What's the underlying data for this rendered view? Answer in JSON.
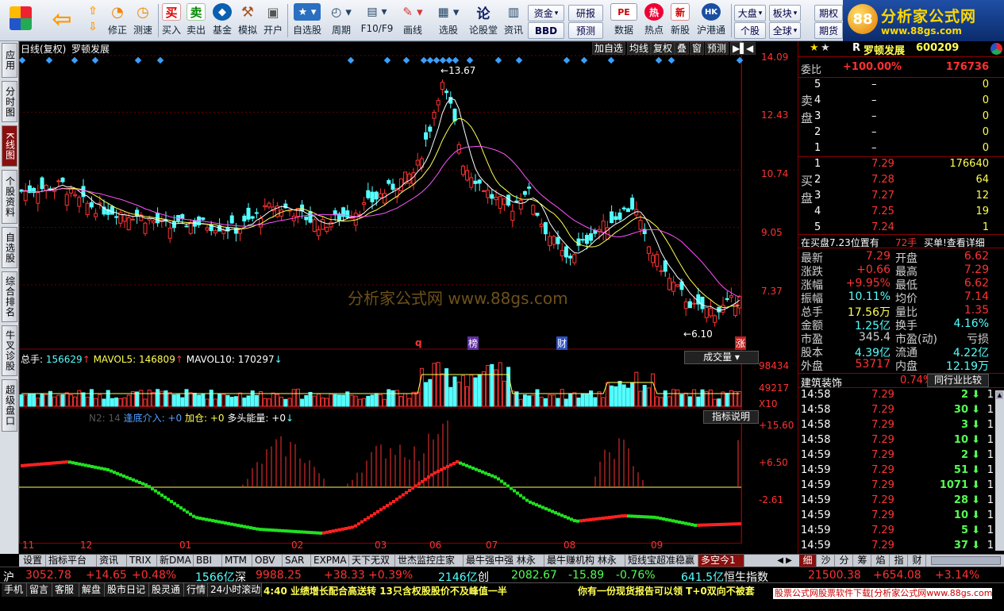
{
  "toolbar": {
    "buttons": [
      {
        "label": "",
        "icon": "grid-icon"
      },
      {
        "label": "",
        "icon": "back-arrow-icon"
      },
      {
        "label": "",
        "icon": "up-down-icon"
      },
      {
        "label": "修正",
        "icon": "fix-icon"
      },
      {
        "label": "测速",
        "icon": "speed-icon"
      },
      {
        "label": "买入",
        "icon": "buy-icon",
        "glyph": "买"
      },
      {
        "label": "卖出",
        "icon": "sell-icon",
        "glyph": "卖"
      },
      {
        "label": "基金",
        "icon": "fund-icon"
      },
      {
        "label": "模拟",
        "icon": "simulate-icon"
      },
      {
        "label": "开户",
        "icon": "lock-icon"
      },
      {
        "label": "自选股",
        "icon": "star-icon"
      },
      {
        "label": "周期",
        "icon": "clock-icon"
      },
      {
        "label": "F10/F9",
        "icon": "f10-icon"
      },
      {
        "label": "画线",
        "icon": "pen-icon"
      },
      {
        "label": "选股",
        "icon": "monitor-icon"
      },
      {
        "label": "论股堂",
        "icon": "forum-icon",
        "glyph": "论"
      },
      {
        "label": "资讯",
        "icon": "news-icon"
      },
      {
        "label": "数据",
        "icon": "pe-icon",
        "glyph": "PE"
      },
      {
        "label": "热点",
        "icon": "hot-icon",
        "glyph": "热"
      },
      {
        "label": "新股",
        "icon": "newstock-icon",
        "glyph": "新"
      },
      {
        "label": "沪港通",
        "icon": "hk-icon",
        "glyph": "HK"
      }
    ],
    "small_buttons": [
      "资金",
      "BBD",
      "研报",
      "预测",
      "大盘",
      "板块",
      "个股",
      "全球",
      "期权",
      "期货"
    ]
  },
  "brand": {
    "logo_text": "88",
    "title": "分析家公式网",
    "url": "www.88gs.com"
  },
  "left_tabs": [
    "应用",
    "分时图",
    "K线图",
    "个股资料",
    "自选股",
    "综合排名",
    "牛叉诊股",
    "超级盘口"
  ],
  "chart": {
    "header_left": "日线(复权)",
    "stock_name": "罗顿发展",
    "top_buttons": [
      "加自选",
      "均线",
      "复权",
      "叠",
      "窗",
      "预测"
    ],
    "price_ticks": [
      "14.09",
      "12.43",
      "10.74",
      "9.05",
      "7.37"
    ],
    "high_label": "13.67",
    "low_label": "6.10",
    "watermark": "分析家公式网  www.88gs.com",
    "event_markers": [
      "q",
      "榜",
      "财",
      "涨"
    ],
    "volume": {
      "total_label": "总手:",
      "total_value": "156629",
      "mavol5_label": "MAVOL5:",
      "mavol5_value": "146809",
      "mavol10_label": "MAVOL10:",
      "mavol10_value": "170297",
      "dropdown": "成交量",
      "ticks": [
        "98434",
        "49217",
        "X10"
      ]
    },
    "indicator": {
      "prefix": "N2: 14",
      "a_label": "逢底介入:",
      "a_value": "+0",
      "b_label": "加仓:",
      "b_value": "+0",
      "c_label": "多头能量:",
      "c_value": "+0",
      "button": "指标说明",
      "ticks": [
        "+15.60",
        "+6.50",
        "-2.61"
      ]
    },
    "months": [
      "11",
      "12",
      "01",
      "02",
      "03",
      "06",
      "07",
      "08",
      "09"
    ]
  },
  "chart_data": {
    "type": "candlestick",
    "price_axis": [
      14.09,
      12.43,
      10.74,
      9.05,
      7.37
    ],
    "high": 13.67,
    "low": 6.1,
    "volume_axis": [
      98434,
      49217
    ],
    "indicator_axis": [
      15.6,
      6.5,
      -2.61
    ],
    "colors": {
      "up": "#ff3232",
      "down": "#54ffff",
      "ma": "#ffffff"
    }
  },
  "right_panel": {
    "title": "罗顿发展",
    "code": "600209",
    "prefix": "R",
    "weibi_label": "委比",
    "weibi_value": "+100.00%",
    "weibi_diff": "176736",
    "sell_label": "卖盘",
    "buy_label": "买盘",
    "sells": [
      {
        "lvl": "5",
        "price": "–",
        "vol": "0"
      },
      {
        "lvl": "4",
        "price": "–",
        "vol": "0"
      },
      {
        "lvl": "3",
        "price": "–",
        "vol": "0"
      },
      {
        "lvl": "2",
        "price": "–",
        "vol": "0"
      },
      {
        "lvl": "1",
        "price": "–",
        "vol": "0"
      }
    ],
    "buys": [
      {
        "lvl": "1",
        "price": "7.29",
        "vol": "176640"
      },
      {
        "lvl": "2",
        "price": "7.28",
        "vol": "64"
      },
      {
        "lvl": "3",
        "price": "7.27",
        "vol": "12"
      },
      {
        "lvl": "4",
        "price": "7.25",
        "vol": "19"
      },
      {
        "lvl": "5",
        "price": "7.24",
        "vol": "1"
      }
    ],
    "notice": "在买盘7.23位置有",
    "notice_vol": "72手",
    "notice_link": "买单!查看详细",
    "stats": [
      {
        "l1": "最新",
        "v1": "7.29",
        "l2": "开盘",
        "v2": "6.62",
        "c1": "#ff3232",
        "c2": "#ff3232"
      },
      {
        "l1": "涨跌",
        "v1": "+0.66",
        "l2": "最高",
        "v2": "7.29",
        "c1": "#ff3232",
        "c2": "#ff3232"
      },
      {
        "l1": "涨幅",
        "v1": "+9.95%",
        "l2": "最低",
        "v2": "6.62",
        "c1": "#ff3232",
        "c2": "#ff3232"
      },
      {
        "l1": "振幅",
        "v1": "10.11%",
        "l2": "均价",
        "v2": "7.14",
        "c1": "#54ffff",
        "c2": "#ff3232"
      },
      {
        "l1": "总手",
        "v1": "17.56万",
        "l2": "量比",
        "v2": "1.35",
        "c1": "#ffff54",
        "c2": "#ff3232"
      },
      {
        "l1": "金额",
        "v1": "1.25亿",
        "l2": "换手",
        "v2": "4.16%",
        "c1": "#54ffff",
        "c2": "#54ffff"
      },
      {
        "l1": "市盈",
        "v1": "345.4",
        "l2": "市盈(动)",
        "v2": "亏损",
        "c1": "#d0d0d0",
        "c2": "#d0d0d0"
      },
      {
        "l1": "股本",
        "v1": "4.39亿",
        "l2": "流通",
        "v2": "4.22亿",
        "c1": "#54ffff",
        "c2": "#54ffff"
      },
      {
        "l1": "外盘",
        "v1": "53717",
        "l2": "内盘",
        "v2": "12.19万",
        "c1": "#ff3232",
        "c2": "#54ffff"
      }
    ],
    "sector": "建筑装饰",
    "sector_pct": "0.74%",
    "compare_button": "同行业比较",
    "ticks": [
      {
        "t": "14:58",
        "p": "7.29",
        "v": "2",
        "n": "1"
      },
      {
        "t": "14:58",
        "p": "7.29",
        "v": "30",
        "n": "1"
      },
      {
        "t": "14:58",
        "p": "7.29",
        "v": "3",
        "n": "1"
      },
      {
        "t": "14:58",
        "p": "7.29",
        "v": "10",
        "n": "1"
      },
      {
        "t": "14:59",
        "p": "7.29",
        "v": "2",
        "n": "1"
      },
      {
        "t": "14:59",
        "p": "7.29",
        "v": "51",
        "n": "1"
      },
      {
        "t": "14:59",
        "p": "7.29",
        "v": "1071",
        "n": "1"
      },
      {
        "t": "14:59",
        "p": "7.29",
        "v": "28",
        "n": "1"
      },
      {
        "t": "14:59",
        "p": "7.29",
        "v": "10",
        "n": "1"
      },
      {
        "t": "14:59",
        "p": "7.29",
        "v": "5",
        "n": "1"
      },
      {
        "t": "14:59",
        "p": "7.29",
        "v": "37",
        "n": "1"
      }
    ]
  },
  "bottom_tabs": [
    "设置",
    "指标平台",
    "资讯",
    "TRIX",
    "新DMA",
    "BBI",
    "MTM",
    "OBV",
    "SAR",
    "EXPMA",
    "天下无双",
    "世杰监控庄家",
    "最牛强中强 林永",
    "最牛赚机构 林永",
    "短线宝超准稳赢",
    "多空今1"
  ],
  "right_bottom_tabs": [
    "细",
    "沙",
    "分",
    "筹",
    "焰",
    "指",
    "财"
  ],
  "index_bar": {
    "sh_label": "沪",
    "sh_value": "3052.78",
    "sh_change": "+14.65",
    "sh_pct": "+0.48%",
    "sh_amount": "1566亿",
    "sz_label": "深",
    "sz_value": "9988.25",
    "sz_change": "+38.33",
    "sz_pct": "+0.39%",
    "sz_amount": "2146亿",
    "cy_label": "创",
    "cy_value": "2082.67",
    "cy_change": "-15.89",
    "cy_pct": "-0.76%",
    "cy_amount": "641.5亿",
    "hs_label": "恒生指数",
    "hs_value": "21500.38",
    "hs_change": "+654.08",
    "hs_pct": "+3.14%"
  },
  "status_bar": {
    "buttons": [
      "手机",
      "留言",
      "客服",
      "解盘",
      "股市日记",
      "股灵通",
      "行情",
      "24小时滚动"
    ],
    "news1": "4:40 业绩增长配合高送转 13只含权股股价不及峰值一半",
    "news2": "你有一份现货报告可以领 T+0双向不被套",
    "footer": "股票公式网股票软件下载[分析家公式网www.88gs.com]"
  }
}
